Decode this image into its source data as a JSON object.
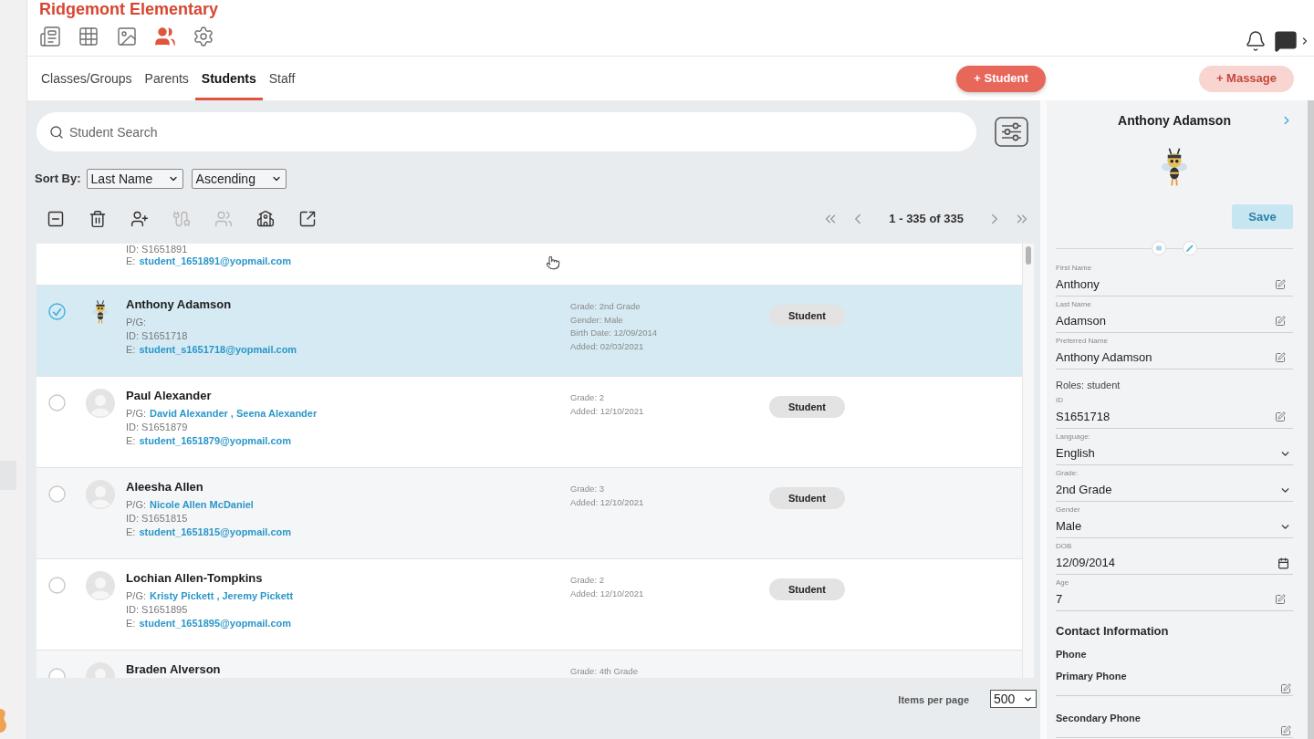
{
  "header": {
    "school": "Ridgemont Elementary",
    "nav": [
      {
        "selected": false
      },
      {
        "selected": false
      },
      {
        "selected": false
      },
      {
        "selected": true
      },
      {
        "selected": false
      }
    ]
  },
  "tabs": [
    {
      "label": "Classes/Groups",
      "selected": false
    },
    {
      "label": "Parents",
      "selected": false
    },
    {
      "label": "Students",
      "selected": true
    },
    {
      "label": "Staff",
      "selected": false
    }
  ],
  "actions": [
    {
      "label": "+ Student",
      "disabled": false
    },
    {
      "label": "+ Massage",
      "disabled": true
    }
  ],
  "search": {
    "placeholder": "Student Search"
  },
  "sort": {
    "label": "Sort By:",
    "field": "Last Name",
    "order": "Ascending"
  },
  "toolbar": [
    {
      "disabled": false
    },
    {
      "disabled": false
    },
    {
      "disabled": false
    },
    {
      "disabled": true
    },
    {
      "disabled": true
    },
    {
      "disabled": false
    },
    {
      "disabled": false
    }
  ],
  "pagination": {
    "range": "1 - 335 of 335"
  },
  "students": [
    {
      "id": "ID: S1651891",
      "email_label": "E:",
      "email": "student_1651891@yopmail.com"
    },
    {
      "name": "Anthony Adamson",
      "selected": true,
      "avatar": {
        "kind": "mascot"
      },
      "pg_label": "P/G:",
      "id": "ID: S1651718",
      "email_label": "E:",
      "email": "student_s1651718@yopmail.com",
      "details": [
        "Grade: 2nd Grade",
        "Gender: Male",
        "Birth Date: 12/09/2014",
        "Added: 02/03/2021"
      ],
      "role": "Student"
    },
    {
      "name": "Paul Alexander",
      "selected": false,
      "avatar": {
        "kind": "default"
      },
      "pg_label": "P/G:",
      "guardians": "David Alexander , Seena Alexander",
      "id": "ID: S1651879",
      "email_label": "E:",
      "email": "student_1651879@yopmail.com",
      "details": [
        "Grade: 2",
        "Added: 12/10/2021"
      ],
      "role": "Student"
    },
    {
      "name": "Aleesha Allen",
      "selected": false,
      "avatar": {
        "kind": "default"
      },
      "pg_label": "P/G:",
      "guardians": "Nicole Allen McDaniel",
      "id": "ID: S1651815",
      "email_label": "E:",
      "email": "student_1651815@yopmail.com",
      "details": [
        "Grade: 3",
        "Added: 12/10/2021"
      ],
      "role": "Student"
    },
    {
      "name": "Lochian Allen-Tompkins",
      "selected": false,
      "avatar": {
        "kind": "default"
      },
      "pg_label": "P/G:",
      "guardians": "Kristy Pickett , Jeremy Pickett",
      "id": "ID: S1651895",
      "email_label": "E:",
      "email": "student_1651895@yopmail.com",
      "details": [
        "Grade: 2",
        "Added: 12/10/2021"
      ],
      "role": "Student"
    },
    {
      "name": "Braden Alverson",
      "selected": false,
      "avatar": {
        "kind": "default"
      },
      "details": [
        "Grade: 4th Grade"
      ]
    }
  ],
  "footer": {
    "label": "Items per page",
    "value": "500"
  },
  "profile": {
    "name": "Anthony Adamson",
    "save": {
      "label": "Save",
      "disabled": true
    },
    "fields": [
      {
        "kind": "text",
        "label": "First Name",
        "value": "Anthony"
      },
      {
        "kind": "text",
        "label": "Last Name",
        "value": "Adamson"
      },
      {
        "kind": "text",
        "label": "Preferred Name",
        "value": "Anthony Adamson"
      },
      {
        "kind": "note",
        "text": "Roles: student"
      },
      {
        "kind": "text",
        "label": "ID",
        "value": "S1651718"
      },
      {
        "kind": "select",
        "label": "Language:",
        "value": "English"
      },
      {
        "kind": "select",
        "label": "Grade:",
        "value": "2nd Grade"
      },
      {
        "kind": "select",
        "label": "Gender",
        "value": "Male"
      },
      {
        "kind": "date",
        "label": "DOB",
        "value": "12/09/2014"
      },
      {
        "kind": "text",
        "label": "Age",
        "value": "7"
      }
    ],
    "contact": {
      "heading": "Contact Information",
      "group": "Phone",
      "phones": [
        {
          "label": "Primary Phone"
        },
        {
          "label": "Secondary Phone"
        }
      ]
    }
  }
}
